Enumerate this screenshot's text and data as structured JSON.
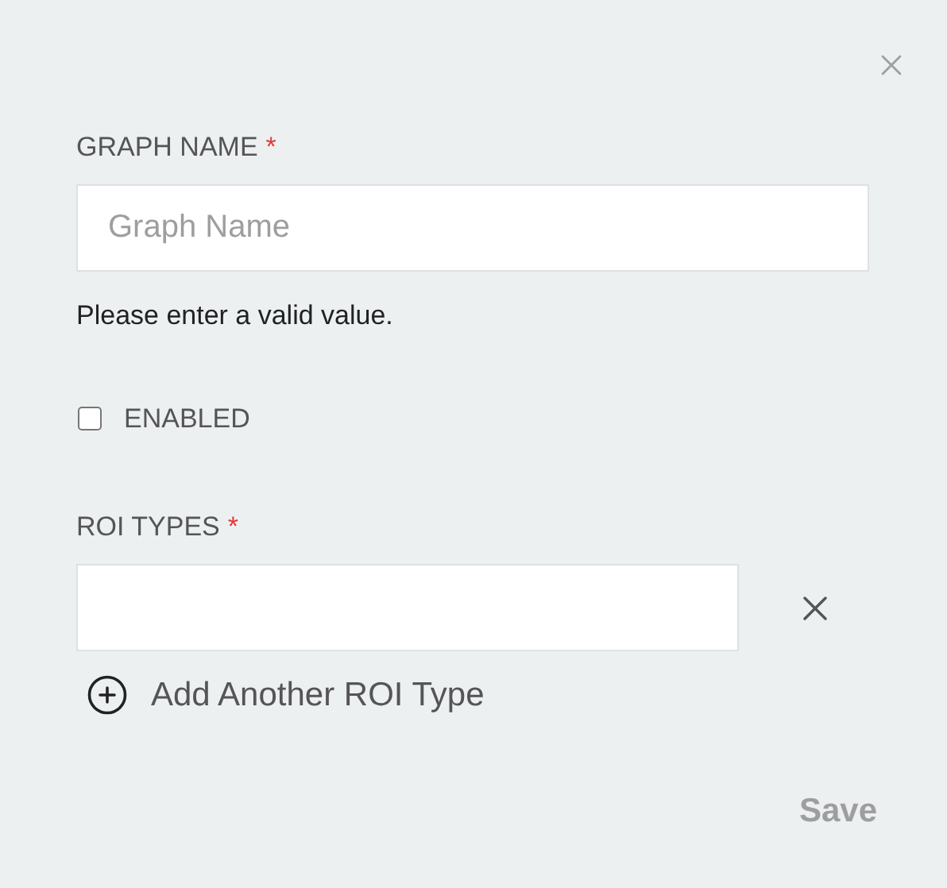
{
  "graph_name": {
    "label": "GRAPH NAME",
    "required_mark": "*",
    "placeholder": "Graph Name",
    "error": "Please enter a valid value."
  },
  "enabled": {
    "label": "ENABLED",
    "checked": false
  },
  "roi_types": {
    "label": "ROI TYPES",
    "required_mark": "*",
    "inputs": [
      {
        "removable": true
      }
    ]
  },
  "add_button": {
    "label": "Add Another ROI Type"
  },
  "save_button": {
    "label": "Save",
    "disabled": true
  }
}
